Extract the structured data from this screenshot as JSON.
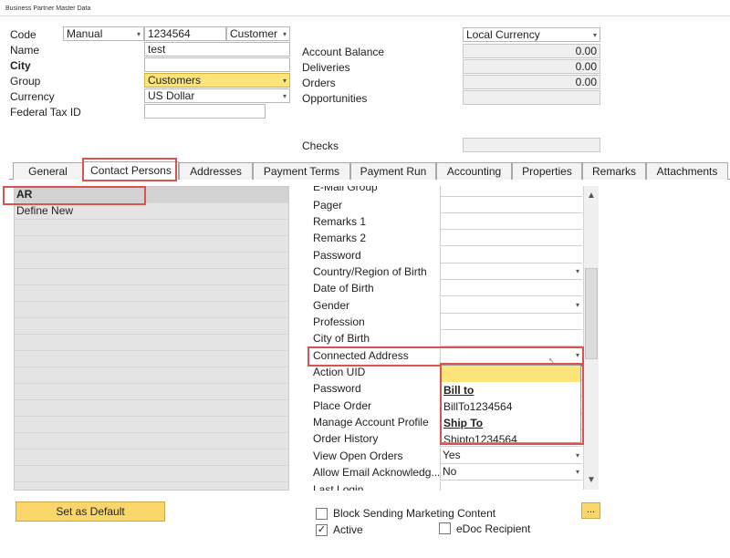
{
  "window": {
    "title": "Business Partner Master Data"
  },
  "header": {
    "code_label": "Code",
    "code_series": "Manual",
    "code_value": "1234564",
    "bp_type": "Customer",
    "name_label": "Name",
    "name_value": "test",
    "city_label": "City",
    "city_value": "",
    "group_label": "Group",
    "group_value": "Customers",
    "currency_label": "Currency",
    "currency_value": "US Dollar",
    "tax_label": "Federal Tax ID",
    "tax_value": "",
    "local_currency": "Local Currency",
    "balance_label": "Account Balance",
    "balance_value": "0.00",
    "deliveries_label": "Deliveries",
    "deliveries_value": "0.00",
    "orders_label": "Orders",
    "orders_value": "0.00",
    "opps_label": "Opportunities",
    "checks_label": "Checks"
  },
  "tabs": [
    "General",
    "Contact Persons",
    "Addresses",
    "Payment Terms",
    "Payment Run",
    "Accounting",
    "Properties",
    "Remarks",
    "Attachments"
  ],
  "contacts": {
    "items": [
      "AR",
      "Define New"
    ]
  },
  "fields": [
    {
      "label": "E-Mail Group",
      "value": ""
    },
    {
      "label": "Pager",
      "value": ""
    },
    {
      "label": "Remarks 1",
      "value": ""
    },
    {
      "label": "Remarks 2",
      "value": ""
    },
    {
      "label": "Password",
      "value": ""
    },
    {
      "label": "Country/Region of Birth",
      "value": ""
    },
    {
      "label": "Date of Birth",
      "value": ""
    },
    {
      "label": "Gender",
      "value": ""
    },
    {
      "label": "Profession",
      "value": ""
    },
    {
      "label": "City of Birth",
      "value": ""
    },
    {
      "label": "Connected Address",
      "value": ""
    },
    {
      "label": "Action UID",
      "value": ""
    },
    {
      "label": "Password",
      "value": ""
    },
    {
      "label": "Place Order",
      "value": ""
    },
    {
      "label": "Manage Account Profile",
      "value": ""
    },
    {
      "label": "Order History",
      "value": ""
    },
    {
      "label": "View Open Orders",
      "value": "Yes"
    },
    {
      "label": "Allow Email Acknowledg...",
      "value": "No"
    },
    {
      "label": "Last Login",
      "value": ""
    }
  ],
  "dropdown": {
    "items": [
      "",
      "Bill to",
      "BillTo1234564",
      "Ship To",
      "Shipto1234564"
    ]
  },
  "footer": {
    "set_default": "Set as Default",
    "block_marketing": "Block Sending Marketing Content",
    "active": "Active",
    "edoc": "eDoc Recipient",
    "ellipsis": "..."
  },
  "colors": {
    "accent_yellow": "#fce47a",
    "highlight_red": "#d9534f"
  }
}
